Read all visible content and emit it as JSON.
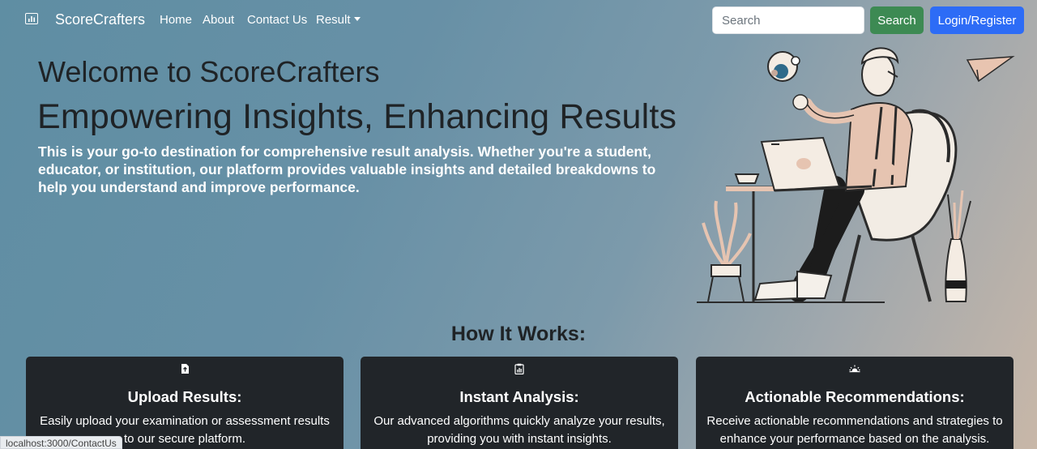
{
  "navbar": {
    "brand": "ScoreCrafters",
    "brand_icon": "bar-chart-icon",
    "links": [
      "Home",
      "About",
      "Contact Us"
    ],
    "dropdown_label": "Result",
    "search_placeholder": "Search",
    "search_button": "Search",
    "login_button": "Login/Register",
    "colors": {
      "search_button": "#3d8a53",
      "login_button": "#2d6cf6"
    }
  },
  "hero": {
    "title": "Welcome to ScoreCrafters",
    "subtitle": "Empowering Insights, Enhancing Results",
    "description": "This is your go-to destination for comprehensive result analysis. Whether you're a student, educator, or institution, our platform provides valuable insights and detailed breakdowns to help you understand and improve performance."
  },
  "how_it_works": {
    "heading": "How It Works:",
    "cards": [
      {
        "icon": "file-upload-icon",
        "title": "Upload Results:",
        "text": "Easily upload your examination or assessment results to our secure platform."
      },
      {
        "icon": "clipboard-data-icon",
        "title": "Instant Analysis:",
        "text": "Our advanced algorithms quickly analyze your results, providing you with instant insights."
      },
      {
        "icon": "sunrise-icon",
        "title": "Actionable Recommendations:",
        "text": "Receive actionable recommendations and strategies to enhance your performance based on the analysis."
      }
    ]
  },
  "status_bar": {
    "url": "localhost:3000/ContactUs"
  }
}
